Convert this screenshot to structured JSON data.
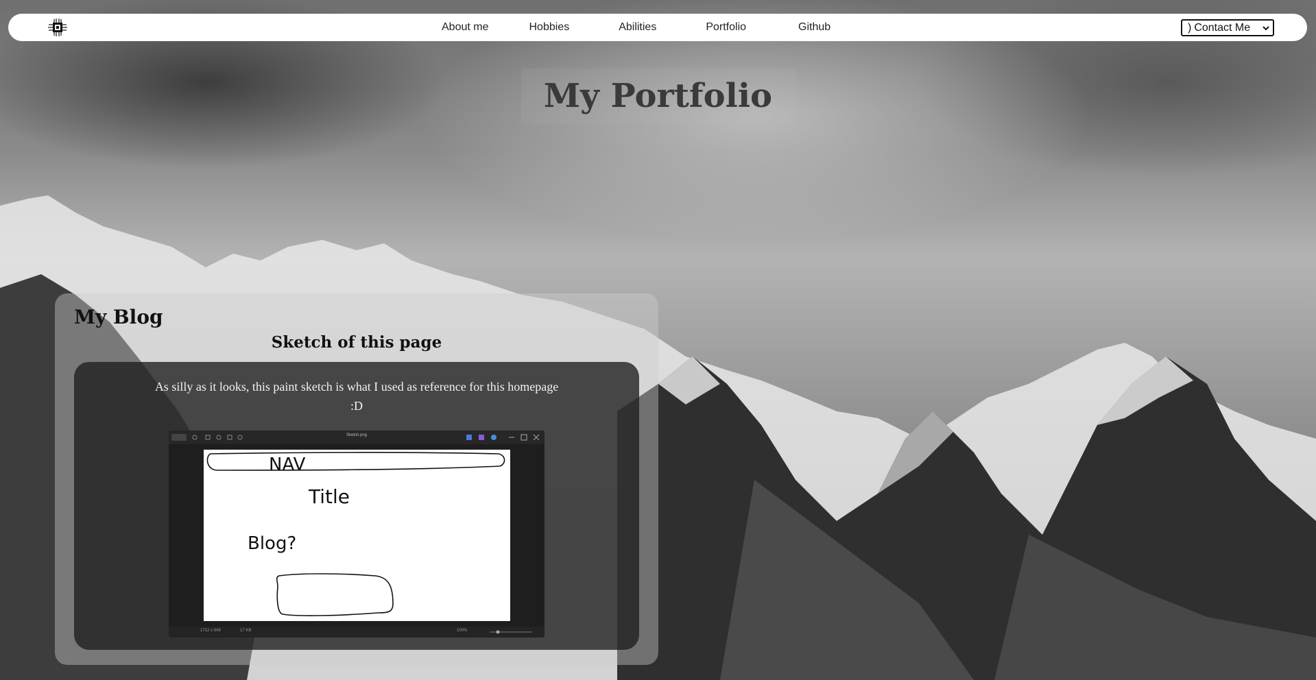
{
  "nav": {
    "links": [
      "About me",
      "Hobbies",
      "Abilities",
      "Portfolio",
      "Github"
    ],
    "contact_select": {
      "selected": "Contact Me",
      "prefix": ")"
    }
  },
  "page_title": "My Portfolio",
  "blog": {
    "heading": "My Blog",
    "post": {
      "title": "Sketch of this page",
      "text_line1": "As silly as it looks, this paint sketch is what I used as reference for this homepage",
      "text_line2": ":D",
      "sketch": {
        "window_title": "Sketch.png",
        "labels": {
          "nav": "NAV",
          "title": "Title",
          "blog": "Blog?"
        },
        "status_left": "1712 x 949",
        "status_size": "17 KB",
        "zoom": "100%"
      }
    }
  },
  "colors": {
    "nav_bg": "#ffffff",
    "title": "#3a3a3a",
    "card_bg": "#1e1e1e"
  }
}
